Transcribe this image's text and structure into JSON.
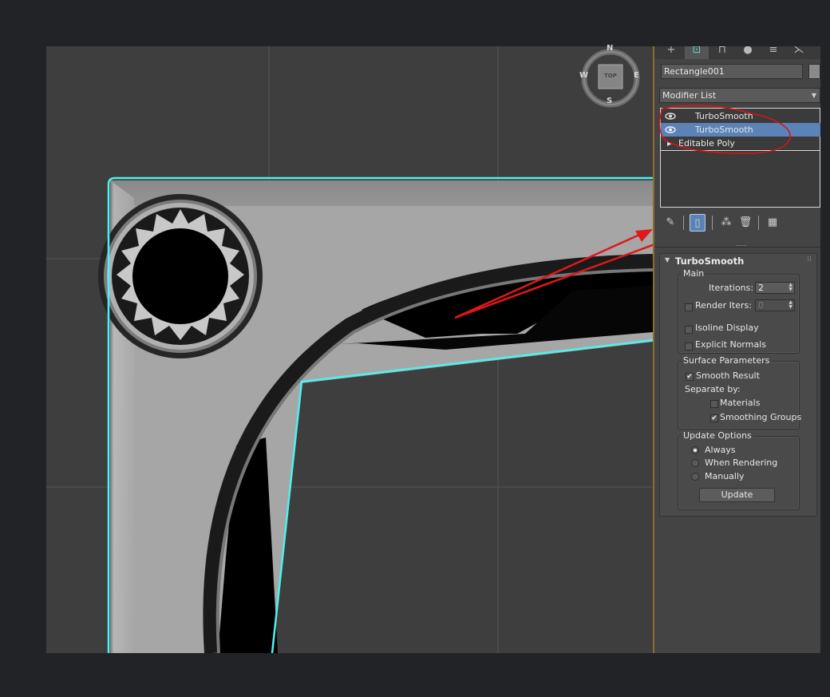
{
  "viewcube": {
    "n": "N",
    "s": "S",
    "e": "E",
    "w": "W",
    "face": "TOP"
  },
  "panel": {
    "tabs": [
      "+",
      "⊡",
      "⊓",
      "●",
      "≡",
      "⋋"
    ],
    "object_name": "Rectangle001",
    "modifier_list": "Modifier List",
    "stack": [
      {
        "label": "TurboSmooth",
        "visible": true,
        "selected": false
      },
      {
        "label": "TurboSmooth",
        "visible": true,
        "selected": true
      },
      {
        "label": "Editable Poly",
        "expandable": true
      }
    ],
    "toolbar": [
      "pin-stack",
      "show-end-result",
      "make-unique",
      "remove-modifier",
      "configure-modifier-sets"
    ]
  },
  "turbosmooth": {
    "title": "TurboSmooth",
    "main": {
      "title": "Main",
      "iterations_label": "Iterations:",
      "iterations_value": "2",
      "render_iters_label": "Render Iters:",
      "render_iters_value": "0",
      "render_iters_checked": false,
      "isoline_label": "Isoline Display",
      "isoline_checked": false,
      "explicit_normals_label": "Explicit Normals",
      "explicit_normals_checked": false
    },
    "surface": {
      "title": "Surface Parameters",
      "smooth_result_label": "Smooth Result",
      "smooth_result_checked": true,
      "separate_by_label": "Separate by:",
      "materials_label": "Materials",
      "materials_checked": false,
      "smoothing_groups_label": "Smoothing Groups",
      "smoothing_groups_checked": true
    },
    "update": {
      "title": "Update Options",
      "always_label": "Always",
      "when_rendering_label": "When Rendering",
      "manually_label": "Manually",
      "selected": "Always",
      "update_button": "Update"
    }
  },
  "colors": {
    "selection_outline": "#4ff0f0",
    "annotation_red": "#e01818",
    "selected_row": "#5b83b8",
    "frame_gray": "#a9a9a9"
  }
}
